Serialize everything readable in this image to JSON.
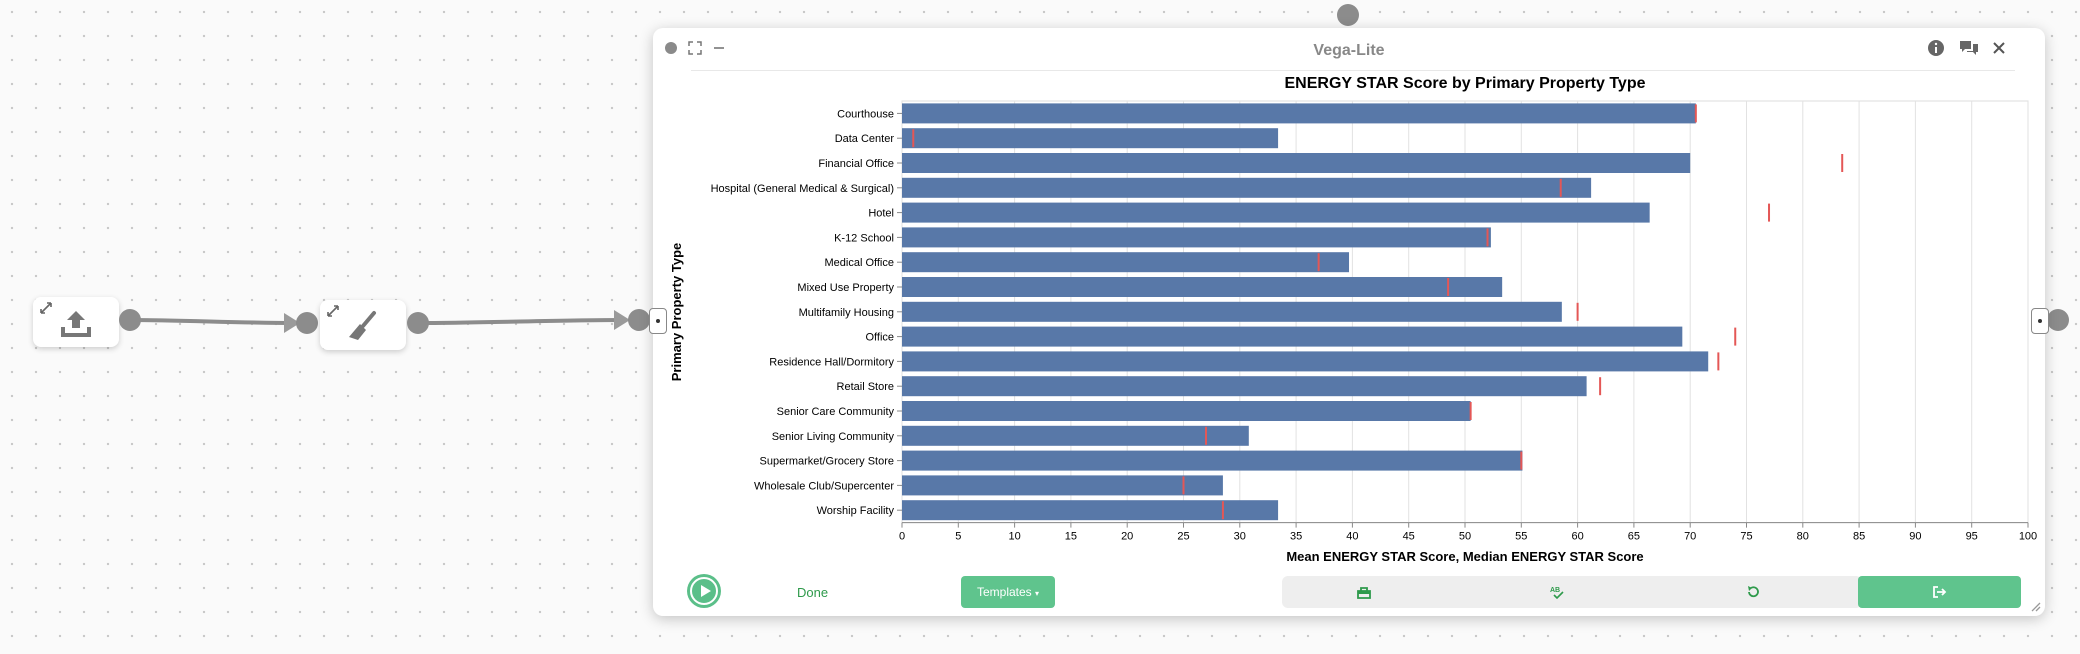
{
  "panel": {
    "title": "Vega-Lite"
  },
  "footer": {
    "done_label": "Done",
    "templates_label": "Templates"
  },
  "icons": {
    "upload_node": "upload-icon",
    "clean_node": "broom-icon",
    "info": "info-icon",
    "comments": "comments-icon",
    "close": "close-icon",
    "fullscreen": "fullscreen-icon",
    "minimize": "minimize-icon",
    "run": "play-icon",
    "tool_box": "box-icon",
    "tool_spell": "spellcheck-icon",
    "tool_undo": "undo-icon",
    "export": "export-icon"
  },
  "colors": {
    "bar": "#5878a8",
    "tick": "#e45756",
    "accent": "#5fc48d",
    "done_text": "#2e9a4b"
  },
  "chart_data": {
    "type": "bar",
    "title": "ENERGY STAR Score by Primary Property Type",
    "xlabel": "Mean ENERGY STAR Score, Median ENERGY STAR Score",
    "ylabel": "Primary Property Type",
    "xlim": [
      0,
      100
    ],
    "xticks": [
      0,
      5,
      10,
      15,
      20,
      25,
      30,
      35,
      40,
      45,
      50,
      55,
      60,
      65,
      70,
      75,
      80,
      85,
      90,
      95,
      100
    ],
    "grid": true,
    "categories": [
      "Courthouse",
      "Data Center",
      "Financial Office",
      "Hospital (General Medical & Surgical)",
      "Hotel",
      "K-12 School",
      "Medical Office",
      "Mixed Use Property",
      "Multifamily Housing",
      "Office",
      "Residence Hall/Dormitory",
      "Retail Store",
      "Senior Care Community",
      "Senior Living Community",
      "Supermarket/Grocery Store",
      "Wholesale Club/Supercenter",
      "Worship Facility"
    ],
    "series": [
      {
        "name": "Mean ENERGY STAR Score",
        "mark": "bar",
        "values": [
          70.5,
          33.4,
          70,
          61.2,
          66.4,
          52.3,
          39.7,
          53.3,
          58.6,
          69.3,
          71.6,
          60.8,
          50.5,
          30.8,
          55.1,
          28.5,
          33.4
        ]
      },
      {
        "name": "Median ENERGY STAR Score",
        "mark": "tick",
        "values": [
          70.5,
          1,
          83.5,
          58.5,
          77,
          52,
          37,
          48.5,
          60,
          74,
          72.5,
          62,
          50.5,
          27,
          55,
          25,
          28.5
        ]
      }
    ]
  }
}
